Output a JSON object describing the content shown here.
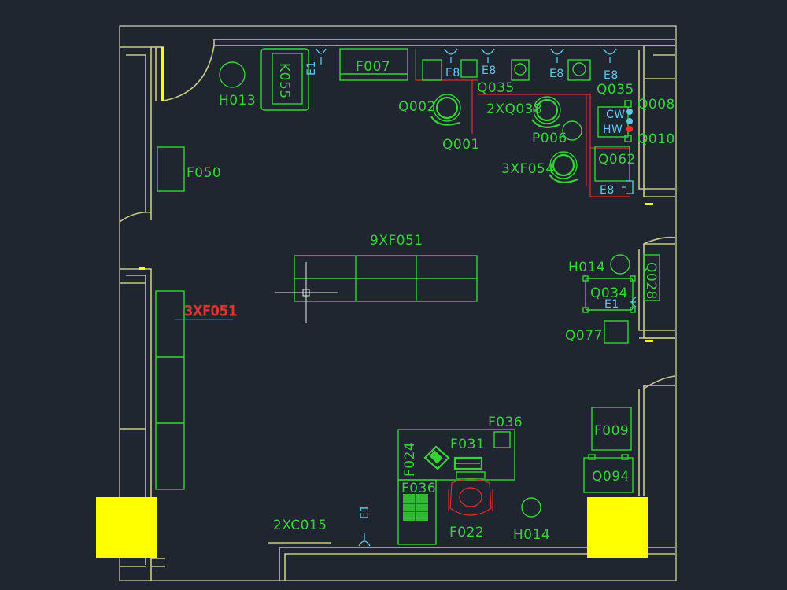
{
  "labels": {
    "k055": "K055",
    "h013": "H013",
    "e1_top": "E1",
    "f007": "F007",
    "e8_a": "E8",
    "e8_b": "E8",
    "e8_c": "E8",
    "e8_d": "E8",
    "q035_a": "Q035",
    "q035_b": "Q035",
    "q002": "Q002",
    "q001": "Q001",
    "q038": "2XQ038",
    "p006": "P006",
    "xf054": "3XF054",
    "q008": "Q008",
    "q010": "Q010",
    "cw": "CW",
    "hw": "HW",
    "q062": "Q062",
    "e8_wall": "E8",
    "f050": "F050",
    "xf051_9": "9XF051",
    "xf051_3": "3XF051",
    "h014_top": "H014",
    "q034": "Q034",
    "e1_right": "E1",
    "q028": "Q028",
    "q077": "Q077",
    "f036_top": "F036",
    "f031": "F031",
    "f024": "F024",
    "f036_bottom": "F036",
    "f022": "F022",
    "h014_bottom": "H014",
    "xc015": "2XC015",
    "e1_bottom": "E1",
    "f009": "F009",
    "q094": "Q094"
  },
  "colors": {
    "background": "#1f2630",
    "equipment": "#39d13a",
    "walls": "#c9c98a",
    "columns": "#ffff00",
    "piping": "#d83030",
    "utilities": "#62c6e8"
  }
}
